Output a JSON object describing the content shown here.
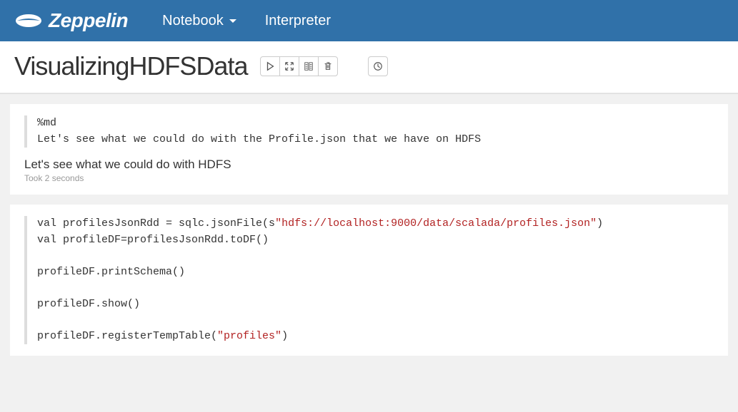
{
  "brand": {
    "name": "Zeppelin"
  },
  "nav": {
    "notebook": "Notebook",
    "interpreter": "Interpreter"
  },
  "page": {
    "title": "VisualizingHDFSData"
  },
  "paragraphs": {
    "p1": {
      "directive": "%md",
      "codeLine": "Let's see what we could do with the Profile.json that we have on HDFS",
      "result": "Let's see what we could do with HDFS",
      "took": "Took 2 seconds"
    },
    "p2": {
      "l1_pre": "val profilesJsonRdd = sqlc.jsonFile(s",
      "l1_str": "\"hdfs://localhost:9000/data/scalada/profiles.json\"",
      "l1_post": ")",
      "l2": "val profileDF=profilesJsonRdd.toDF()",
      "l3": "profileDF.printSchema()",
      "l4": "profileDF.show()",
      "l5_pre": "profileDF.registerTempTable(",
      "l5_str": "\"profiles\"",
      "l5_post": ")"
    }
  }
}
